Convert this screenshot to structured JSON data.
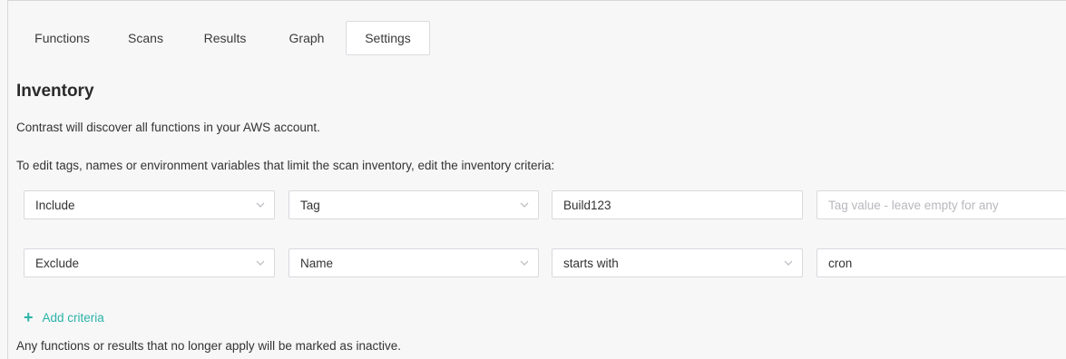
{
  "tabs": [
    {
      "label": "Functions",
      "active": false
    },
    {
      "label": "Scans",
      "active": false
    },
    {
      "label": "Results",
      "active": false
    },
    {
      "label": "Graph",
      "active": false
    },
    {
      "label": "Settings",
      "active": true
    }
  ],
  "inventory": {
    "title": "Inventory",
    "description": "Contrast will discover all functions in your AWS account.",
    "instruction": "To edit tags, names or environment variables that limit the scan inventory, edit the inventory criteria:"
  },
  "criteria": [
    {
      "mode": "Include",
      "type": "Tag",
      "key": "Build123",
      "value": "",
      "value_placeholder": "Tag value - leave empty for any"
    },
    {
      "mode": "Exclude",
      "type": "Name",
      "operator": "starts with",
      "value": "cron"
    }
  ],
  "add_criteria_label": "Add criteria",
  "footer_note": "Any functions or results that no longer apply will be marked as inactive.",
  "colors": {
    "accent": "#2bb3a8",
    "background": "#f7f7f8",
    "border": "#d9d9de"
  },
  "icons": {
    "dropdown": "chevron-down-icon",
    "add": "plus-icon"
  }
}
